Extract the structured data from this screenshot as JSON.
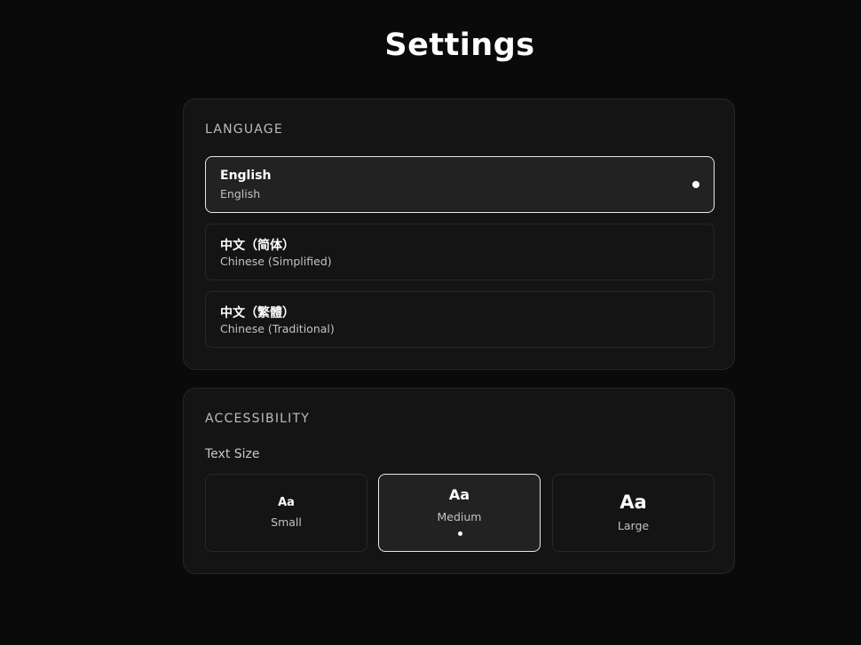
{
  "page": {
    "title": "Settings"
  },
  "language": {
    "section_label": "LANGUAGE",
    "selected_index": 0,
    "options": [
      {
        "name": "English",
        "subtitle": "English",
        "selected": true
      },
      {
        "name": "中文（简体）",
        "subtitle": "Chinese (Simplified)",
        "selected": false
      },
      {
        "name": "中文（繁體）",
        "subtitle": "Chinese (Traditional)",
        "selected": false
      }
    ]
  },
  "accessibility": {
    "section_label": "ACCESSIBILITY",
    "text_size_label": "Text Size",
    "selected_index": 1,
    "sizes": [
      {
        "sample": "Aa",
        "label": "Small",
        "selected": false
      },
      {
        "sample": "Aa",
        "label": "Medium",
        "selected": true
      },
      {
        "sample": "Aa",
        "label": "Large",
        "selected": false
      }
    ]
  },
  "colors": {
    "background": "#0a0a0a",
    "card": "#141414",
    "selected_fill": "#222222",
    "selected_border": "#e8e8e8",
    "text_primary": "#ffffff",
    "text_secondary": "#c2c2c2"
  }
}
